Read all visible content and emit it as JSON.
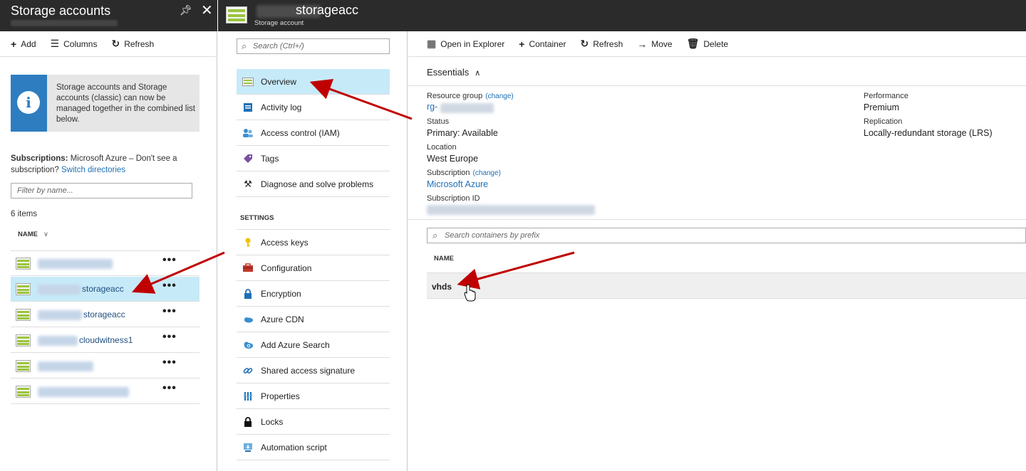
{
  "blade1": {
    "title": "Storage accounts",
    "toolbar": {
      "add": "Add",
      "columns": "Columns",
      "refresh": "Refresh"
    },
    "info_text": "Storage accounts and Storage accounts (classic) can now be managed together in the combined list below.",
    "subscriptions_label": "Subscriptions:",
    "subscriptions_text": "Microsoft Azure – Don't see a subscription?",
    "switch_link": "Switch directories",
    "filter_placeholder": "Filter by name...",
    "items_count": "6 items",
    "col_name": "NAME",
    "more": "•••",
    "rows": [
      {
        "name": ""
      },
      {
        "name": "storageacc"
      },
      {
        "name": "storageacc"
      },
      {
        "name": "cloudwitness1"
      },
      {
        "name": ""
      },
      {
        "name": ""
      }
    ]
  },
  "blade2": {
    "title": "storageacc",
    "subtitle": "Storage account",
    "search_placeholder": "Search (Ctrl+/)",
    "settings_label": "SETTINGS",
    "menu_top": [
      {
        "label": "Overview",
        "icon": "overview-icon"
      },
      {
        "label": "Activity log",
        "icon": "activity-log-icon"
      },
      {
        "label": "Access control (IAM)",
        "icon": "iam-icon"
      },
      {
        "label": "Tags",
        "icon": "tag-icon"
      },
      {
        "label": "Diagnose and solve problems",
        "icon": "wrench-icon"
      }
    ],
    "menu_settings": [
      {
        "label": "Access keys",
        "icon": "key-icon"
      },
      {
        "label": "Configuration",
        "icon": "toolbox-icon"
      },
      {
        "label": "Encryption",
        "icon": "lock-icon"
      },
      {
        "label": "Azure CDN",
        "icon": "cloud-icon"
      },
      {
        "label": "Add Azure Search",
        "icon": "cloud-search-icon"
      },
      {
        "label": "Shared access signature",
        "icon": "link-icon"
      },
      {
        "label": "Properties",
        "icon": "properties-icon"
      },
      {
        "label": "Locks",
        "icon": "lock-icon"
      },
      {
        "label": "Automation script",
        "icon": "download-icon"
      }
    ]
  },
  "blade3": {
    "toolbar": {
      "open_explorer": "Open in Explorer",
      "container": "Container",
      "refresh": "Refresh",
      "move": "Move",
      "delete": "Delete"
    },
    "essentials": "Essentials",
    "props": {
      "resource_group_label": "Resource group",
      "change": "(change)",
      "resource_group_value": "rg-",
      "status_label": "Status",
      "status_value": "Primary: Available",
      "location_label": "Location",
      "location_value": "West Europe",
      "subscription_label": "Subscription",
      "subscription_value": "Microsoft Azure",
      "subscription_id_label": "Subscription ID",
      "performance_label": "Performance",
      "performance_value": "Premium",
      "replication_label": "Replication",
      "replication_value": "Locally-redundant storage (LRS)"
    },
    "container_search_placeholder": "Search containers by prefix",
    "col_name": "NAME",
    "containers": [
      {
        "name": "vhds"
      }
    ]
  },
  "colors": {
    "topbar": "#2b2b2b",
    "selected": "#c7eaf8",
    "link": "#1f6fb5",
    "info_accent": "#2e7dc0",
    "arrow": "#c00000"
  }
}
